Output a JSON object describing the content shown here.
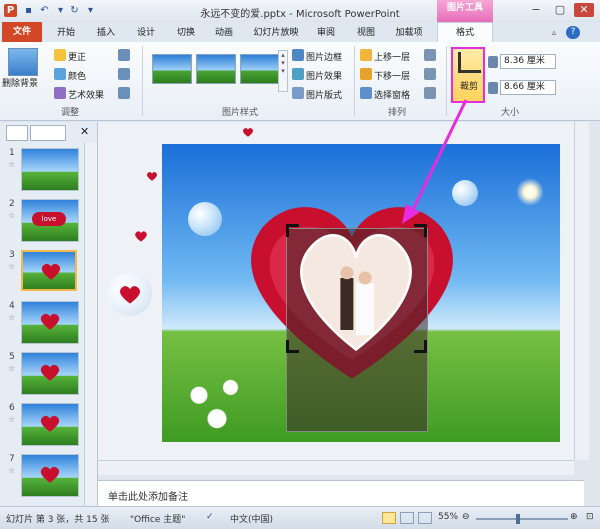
{
  "window": {
    "title": "永远不变的爱.pptx - Microsoft PowerPoint",
    "context_tab_group": "图片工具",
    "min": "−",
    "max": "▢",
    "close": "✕"
  },
  "tabs": [
    "文件",
    "开始",
    "插入",
    "设计",
    "切换",
    "动画",
    "幻灯片放映",
    "审阅",
    "视图",
    "加载项",
    "格式"
  ],
  "ribbon": {
    "adjust": {
      "remove_bg": "删除背景",
      "corrections": "更正",
      "color": "颜色",
      "artistic": "艺术效果",
      "label": "调整"
    },
    "styles": {
      "border": "图片边框",
      "effects": "图片效果",
      "layout": "图片版式",
      "label": "图片样式"
    },
    "arrange": {
      "forward": "上移一层",
      "backward": "下移一层",
      "selection_pane": "选择窗格",
      "label": "排列"
    },
    "size": {
      "crop": "裁剪",
      "height": "8.36 厘米",
      "width": "8.66 厘米",
      "label": "大小"
    }
  },
  "slides": [
    {
      "num": "1"
    },
    {
      "num": "2"
    },
    {
      "num": "3"
    },
    {
      "num": "4"
    },
    {
      "num": "5"
    },
    {
      "num": "6"
    },
    {
      "num": "7"
    }
  ],
  "thumb_label": "love",
  "slide_star": "☆",
  "notes_placeholder": "单击此处添加备注",
  "status": {
    "slide_info": "幻灯片 第 3 张，共 15 张",
    "theme": "\"Office 主题\"",
    "lang": "中文(中国)",
    "zoom": "55%"
  },
  "colors": {
    "accent": "#d24726",
    "crop_highlight": "#e52ce0",
    "heart": "#c8102e"
  }
}
